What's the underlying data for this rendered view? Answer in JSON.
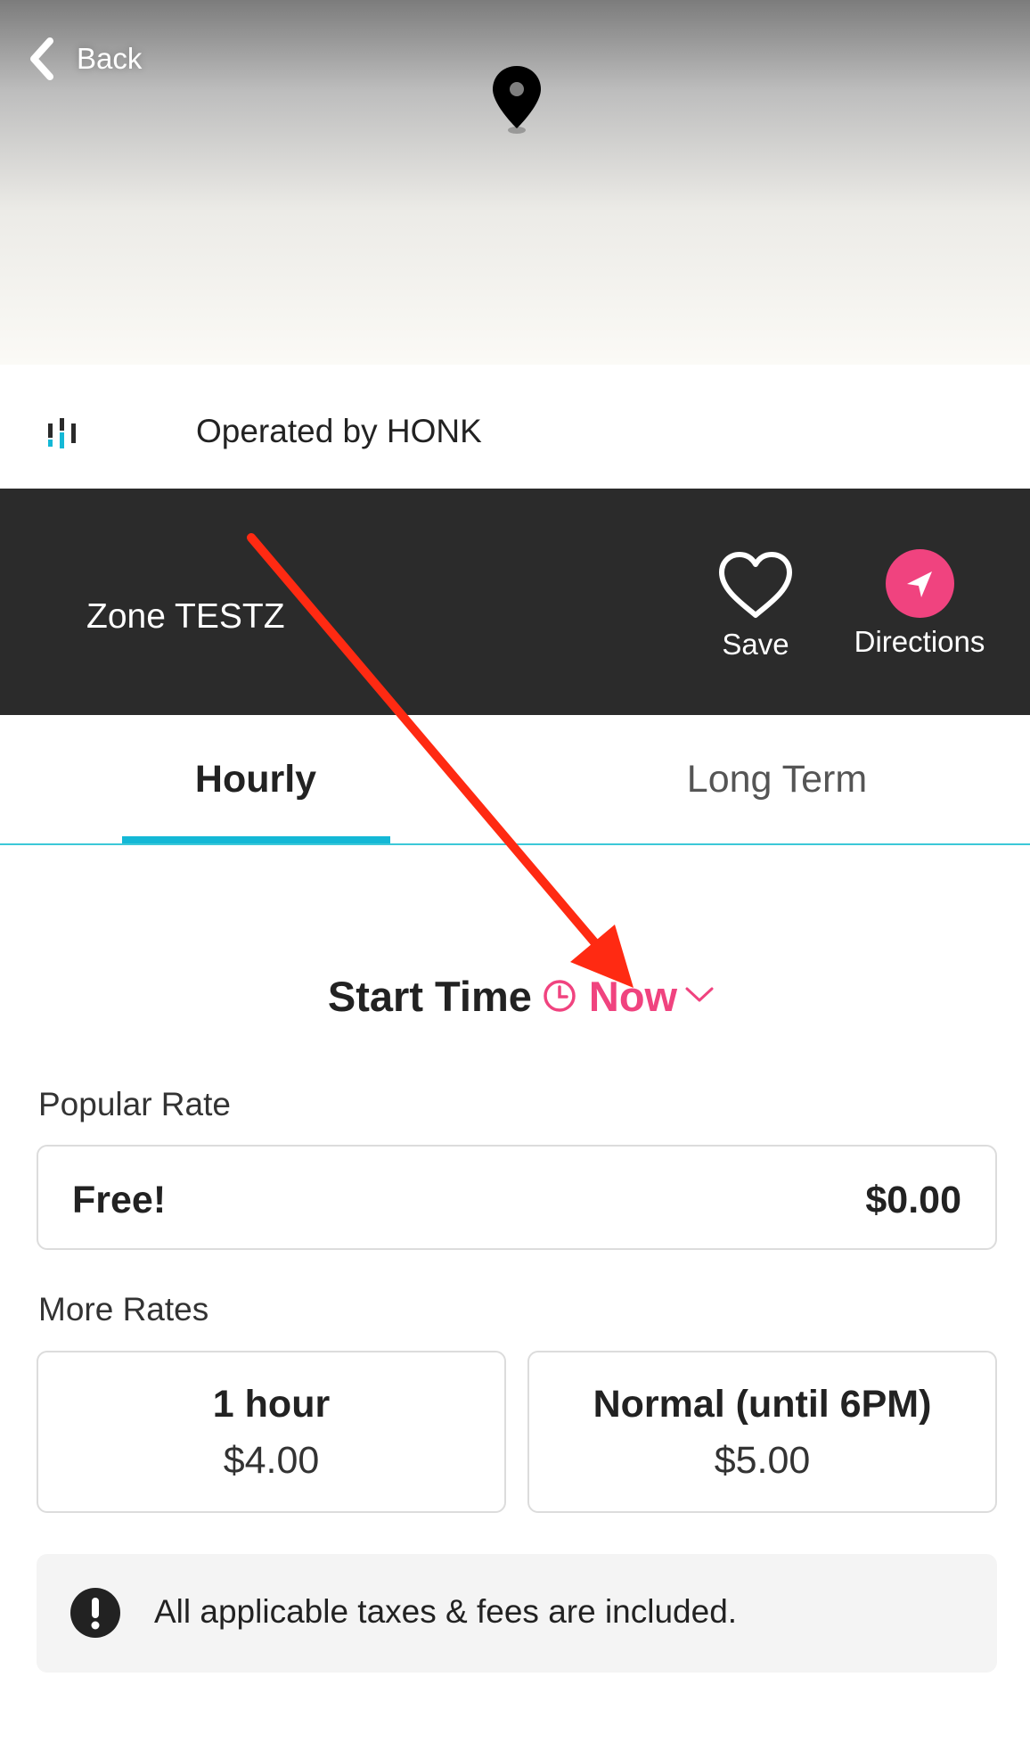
{
  "header": {
    "back_label": "Back",
    "icons": {
      "back": "chevron-left-icon",
      "pin": "map-pin-icon"
    }
  },
  "operator": {
    "text": "Operated by HONK",
    "logo": "honk-logo"
  },
  "zone": {
    "name": "Zone TESTZ",
    "save_label": "Save",
    "directions_label": "Directions",
    "icons": {
      "save": "heart-icon",
      "directions": "navigation-arrow-icon"
    }
  },
  "tabs": [
    {
      "label": "Hourly",
      "active": true
    },
    {
      "label": "Long Term",
      "active": false
    }
  ],
  "start_time": {
    "label": "Start Time",
    "value": "Now",
    "icons": [
      "clock-icon",
      "chevron-down-icon"
    ]
  },
  "popular": {
    "section_label": "Popular Rate",
    "name": "Free!",
    "price": "$0.00"
  },
  "more_rates": {
    "section_label": "More Rates",
    "items": [
      {
        "name": "1 hour",
        "price": "$4.00"
      },
      {
        "name": "Normal (until 6PM)",
        "price": "$5.00"
      }
    ]
  },
  "notice": {
    "text": "All applicable taxes & fees are included.",
    "icon": "exclamation-circle-icon"
  },
  "colors": {
    "accent_pink": "#f0437f",
    "tab_underline": "#14b8d6",
    "zone_bar_bg": "#2b2b2b",
    "annotation_arrow": "#ff2a12"
  }
}
